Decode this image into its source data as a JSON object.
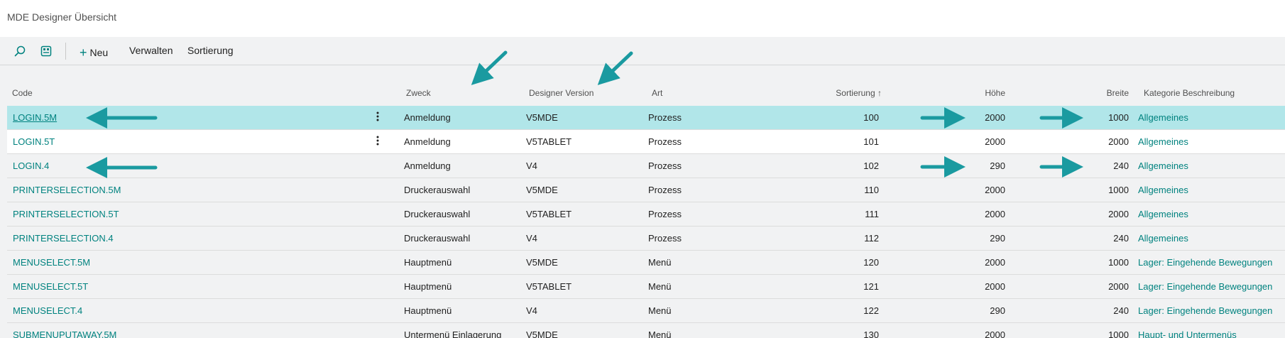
{
  "title": "MDE Designer Übersicht",
  "toolbar": {
    "search_icon": "search-icon",
    "layout_icon": "layout-icon",
    "new_label": "Neu",
    "manage_label": "Verwalten",
    "sort_label": "Sortierung"
  },
  "columns": {
    "code": "Code",
    "zweck": "Zweck",
    "designer_version": "Designer Version",
    "art": "Art",
    "sortierung": "Sortierung",
    "sort_arrow": "↑",
    "hoehe": "Höhe",
    "breite": "Breite",
    "kategorie": "Kategorie Beschreibung"
  },
  "rows": [
    {
      "code": "LOGIN.5M",
      "zweck": "Anmeldung",
      "version": "V5MDE",
      "art": "Prozess",
      "sortierung": "100",
      "hoehe": "2000",
      "breite": "1000",
      "kategorie": "Allgemeines"
    },
    {
      "code": "LOGIN.5T",
      "zweck": "Anmeldung",
      "version": "V5TABLET",
      "art": "Prozess",
      "sortierung": "101",
      "hoehe": "2000",
      "breite": "2000",
      "kategorie": "Allgemeines"
    },
    {
      "code": "LOGIN.4",
      "zweck": "Anmeldung",
      "version": "V4",
      "art": "Prozess",
      "sortierung": "102",
      "hoehe": "290",
      "breite": "240",
      "kategorie": "Allgemeines"
    },
    {
      "code": "PRINTERSELECTION.5M",
      "zweck": "Druckerauswahl",
      "version": "V5MDE",
      "art": "Prozess",
      "sortierung": "110",
      "hoehe": "2000",
      "breite": "1000",
      "kategorie": "Allgemeines"
    },
    {
      "code": "PRINTERSELECTION.5T",
      "zweck": "Druckerauswahl",
      "version": "V5TABLET",
      "art": "Prozess",
      "sortierung": "111",
      "hoehe": "2000",
      "breite": "2000",
      "kategorie": "Allgemeines"
    },
    {
      "code": "PRINTERSELECTION.4",
      "zweck": "Druckerauswahl",
      "version": "V4",
      "art": "Prozess",
      "sortierung": "112",
      "hoehe": "290",
      "breite": "240",
      "kategorie": "Allgemeines"
    },
    {
      "code": "MENUSELECT.5M",
      "zweck": "Hauptmenü",
      "version": "V5MDE",
      "art": "Menü",
      "sortierung": "120",
      "hoehe": "2000",
      "breite": "1000",
      "kategorie": "Lager: Eingehende Bewegungen"
    },
    {
      "code": "MENUSELECT.5T",
      "zweck": "Hauptmenü",
      "version": "V5TABLET",
      "art": "Menü",
      "sortierung": "121",
      "hoehe": "2000",
      "breite": "2000",
      "kategorie": "Lager: Eingehende Bewegungen"
    },
    {
      "code": "MENUSELECT.4",
      "zweck": "Hauptmenü",
      "version": "V4",
      "art": "Menü",
      "sortierung": "122",
      "hoehe": "290",
      "breite": "240",
      "kategorie": "Lager: Eingehende Bewegungen"
    },
    {
      "code": "SUBMENUPUTAWAY.5M",
      "zweck": "Untermenü Einlagerung",
      "version": "V5MDE",
      "art": "Menü",
      "sortierung": "130",
      "hoehe": "2000",
      "breite": "1000",
      "kategorie": "Haupt- und Untermenüs"
    }
  ],
  "colors": {
    "accent": "#00827f",
    "selected_row": "#b1e6e9",
    "annotation_arrow": "#1a9aa0"
  }
}
